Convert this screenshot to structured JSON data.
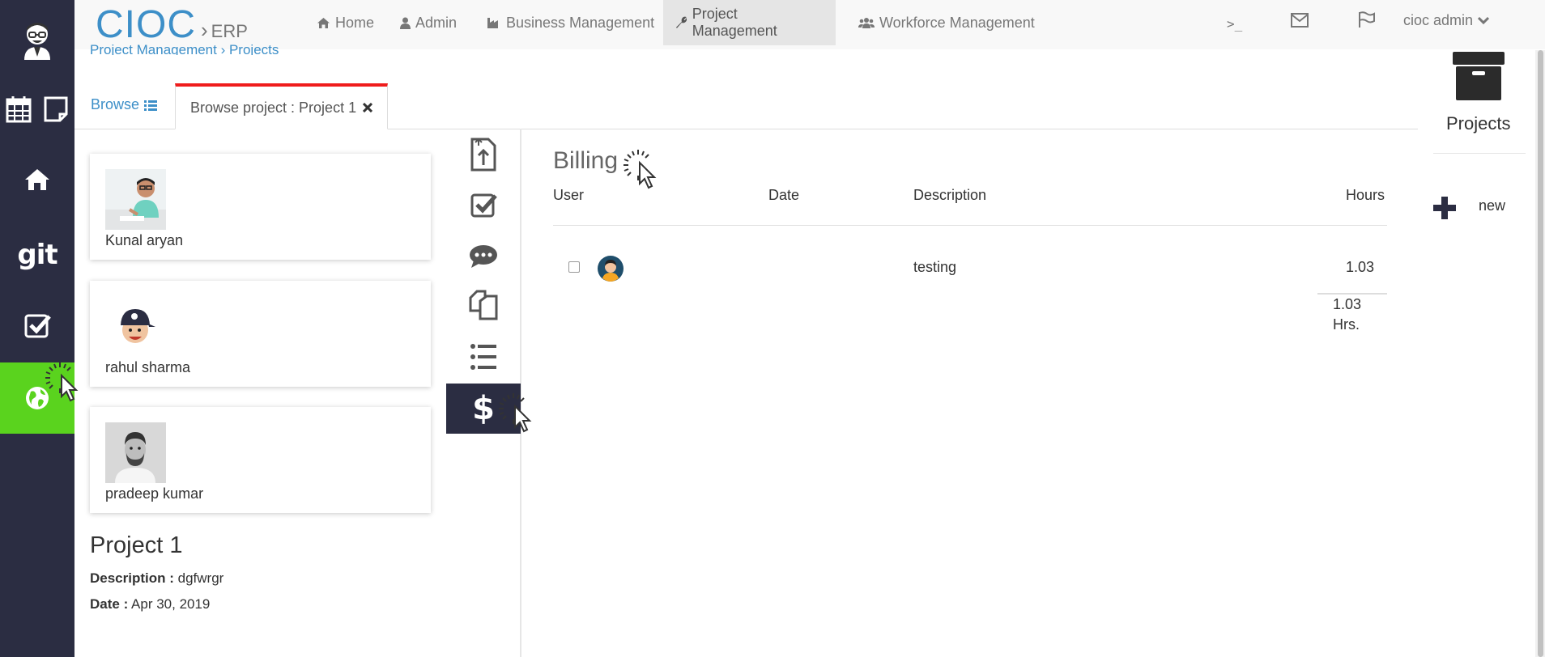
{
  "brand": {
    "name": "CIOC",
    "sep": "›",
    "sub": "ERP"
  },
  "nav": {
    "home": "Home",
    "admin": "Admin",
    "business": "Business Management",
    "project": "Project Management",
    "workforce": "Workforce Management",
    "terminal": ">_",
    "user": "cioc admin"
  },
  "breadcrumb": "Project Management › Projects",
  "sidebar": {
    "git": "git"
  },
  "tabs": {
    "browse": "Browse",
    "active": "Browse project : Project 1"
  },
  "members": [
    {
      "name": "Kunal aryan"
    },
    {
      "name": "rahul sharma"
    },
    {
      "name": "pradeep kumar"
    }
  ],
  "project": {
    "title": "Project 1",
    "desc_label": "Description :",
    "desc_value": "dgfwrgr",
    "date_label": "Date :",
    "date_value": "Apr 30, 2019"
  },
  "billing": {
    "title": "Billing",
    "headers": {
      "user": "User",
      "date": "Date",
      "description": "Description",
      "hours": "Hours"
    },
    "rows": [
      {
        "date": "",
        "description": "testing",
        "hours": "1.03"
      }
    ],
    "total": "1.03",
    "total_unit": "Hrs."
  },
  "right": {
    "title": "Projects",
    "new": "new"
  },
  "colors": {
    "sidebar": "#2b2d42",
    "active_green": "#5ad31e",
    "brand_blue": "#3d8fc8",
    "tab_red": "#ef1c1c"
  }
}
